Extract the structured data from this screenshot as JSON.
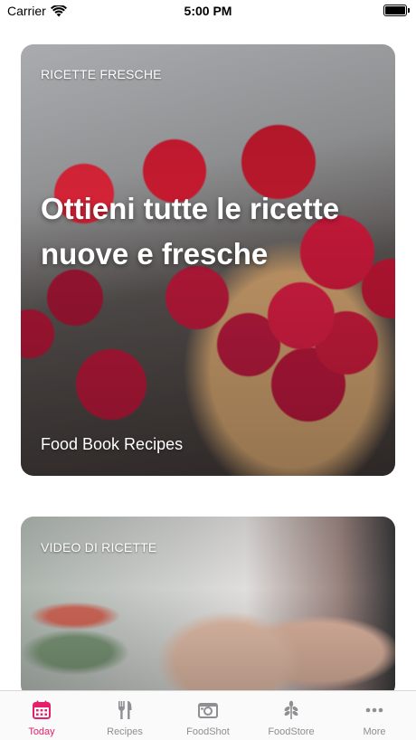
{
  "status_bar": {
    "carrier": "Carrier",
    "time": "5:00 PM"
  },
  "cards": [
    {
      "kicker": "RICETTE FRESCHE",
      "title": "Ottieni tutte le ricette nuove e fresche",
      "footer": "Food Book Recipes"
    },
    {
      "kicker": "VIDEO DI RICETTE"
    }
  ],
  "tab_bar": {
    "accent_color": "#e5206a",
    "inactive_color": "#8e8e93",
    "tabs": [
      {
        "label": "Today",
        "icon": "calendar-icon",
        "active": true
      },
      {
        "label": "Recipes",
        "icon": "fork-knife-icon",
        "active": false
      },
      {
        "label": "FoodShot",
        "icon": "camera-icon",
        "active": false
      },
      {
        "label": "FoodStore",
        "icon": "leaf-icon",
        "active": false
      },
      {
        "label": "More",
        "icon": "more-icon",
        "active": false
      }
    ]
  }
}
